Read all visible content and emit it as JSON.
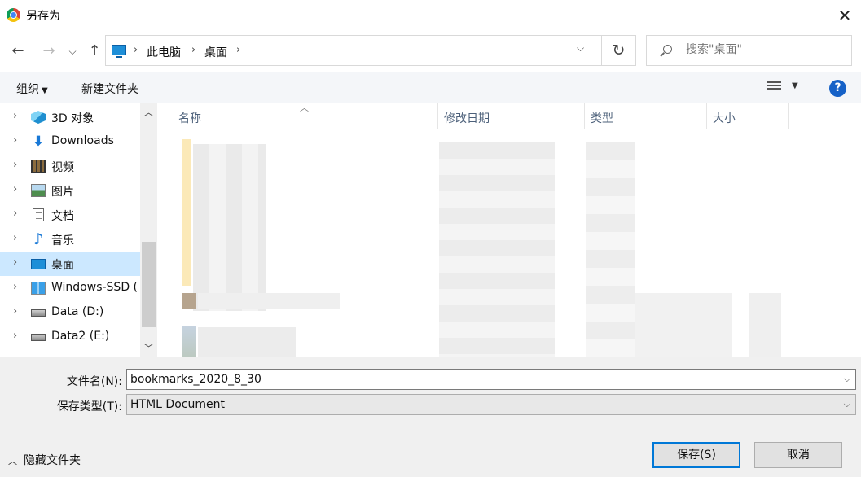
{
  "window": {
    "title": "另存为",
    "close": "✕"
  },
  "nav": {
    "back": "←",
    "forward": "→",
    "recent": "⌵",
    "up": "↑"
  },
  "address": {
    "crumbs": [
      "此电脑",
      "桌面"
    ],
    "separator": "›",
    "dropdown": "⌵",
    "refresh": "↻"
  },
  "search": {
    "placeholder": "搜索\"桌面\""
  },
  "commandbar": {
    "organize": "组织",
    "new_folder": "新建文件夹",
    "help": "?"
  },
  "sidebar": {
    "items": [
      {
        "label": "3D 对象",
        "icon": "3d-objects-icon"
      },
      {
        "label": "Downloads",
        "icon": "download-icon"
      },
      {
        "label": "视频",
        "icon": "video-icon"
      },
      {
        "label": "图片",
        "icon": "pictures-icon"
      },
      {
        "label": "文档",
        "icon": "documents-icon"
      },
      {
        "label": "音乐",
        "icon": "music-icon"
      },
      {
        "label": "桌面",
        "icon": "desktop-icon",
        "selected": true
      },
      {
        "label": "Windows-SSD (",
        "icon": "windows-drive-icon"
      },
      {
        "label": "Data (D:)",
        "icon": "drive-icon"
      },
      {
        "label": "Data2 (E:)",
        "icon": "drive-icon"
      }
    ]
  },
  "filelist": {
    "columns": [
      "名称",
      "修改日期",
      "类型",
      "大小"
    ]
  },
  "bottom": {
    "filename_label": "文件名(N):",
    "filename_value": "bookmarks_2020_8_30",
    "filetype_label": "保存类型(T):",
    "filetype_value": "HTML Document",
    "hide_folders": "隐藏文件夹",
    "save": "保存(S)",
    "cancel": "取消"
  },
  "colors": {
    "selection": "#cce8ff",
    "accent": "#0078d7",
    "help": "#1561c7"
  }
}
